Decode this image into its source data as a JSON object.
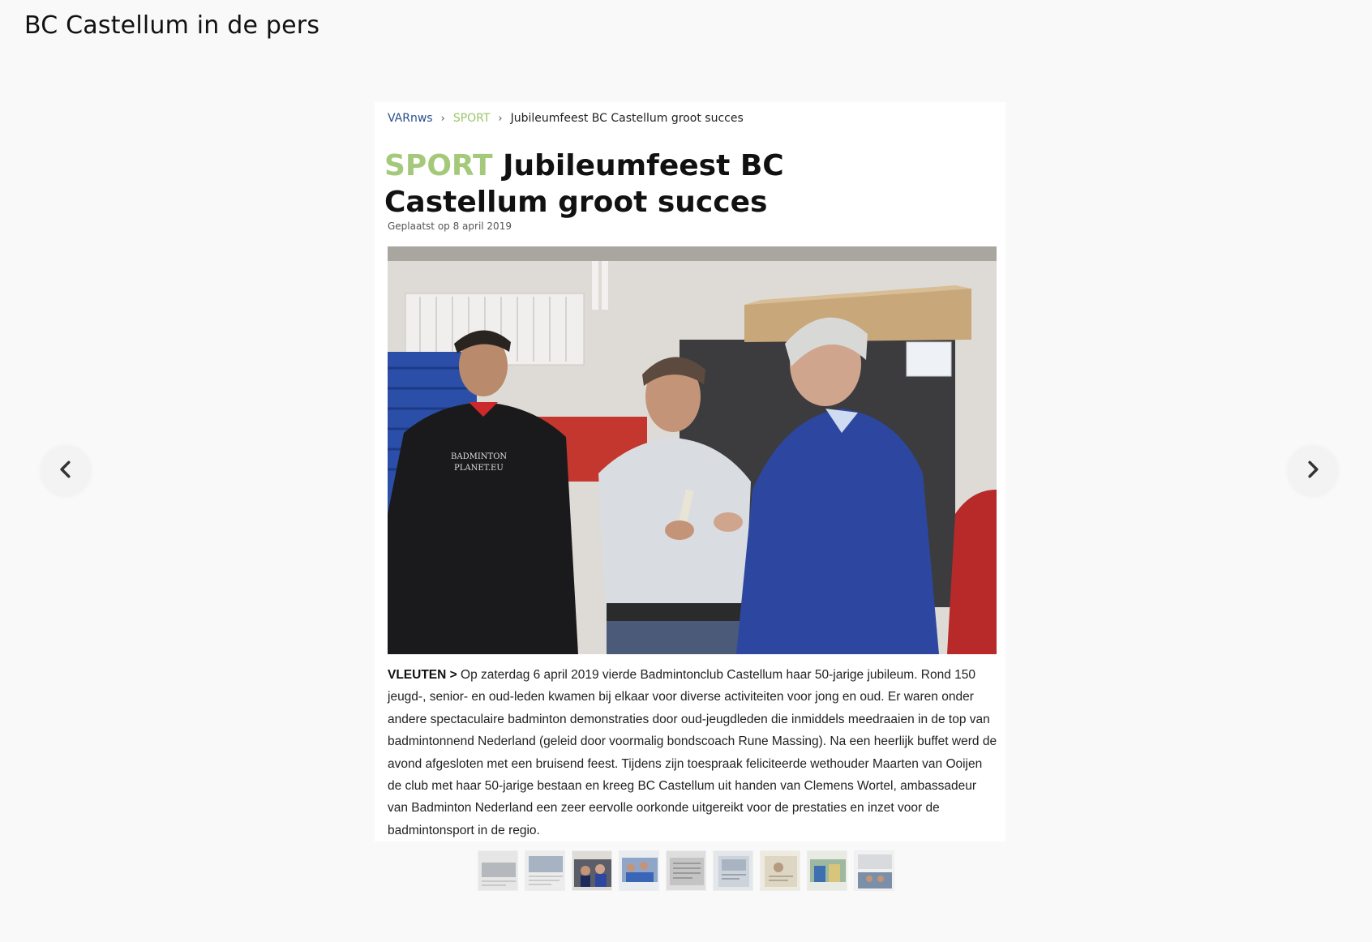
{
  "page": {
    "title": "BC Castellum in de pers"
  },
  "navigation": {
    "prev_icon": "chevron-left-icon",
    "next_icon": "chevron-right-icon"
  },
  "slide": {
    "breadcrumb": {
      "home": "VARnws",
      "separator": "›",
      "section": "SPORT",
      "current": "Jubileumfeest BC Castellum groot succes"
    },
    "headline": {
      "kicker": "SPORT",
      "title": "Jubileumfeest BC Castellum groot succes"
    },
    "posted": "Geplaatst op 8 april 2019",
    "photo_jacket_text": "BADMINTON PLANET.EU",
    "article": {
      "dateline": "VLEUTEN >",
      "body": "Op zaterdag 6 april 2019 vierde Badmintonclub Castellum haar 50-jarige jubileum. Rond 150 jeugd-, senior- en oud-leden kwamen bij elkaar voor diverse activiteiten voor jong en oud. Er waren onder andere spectaculaire badminton demonstraties door oud-jeugdleden die inmiddels meedraaien in de top van badmintonnend Nederland (geleid door voormalig bondscoach Rune Massing). Na een heerlijk buffet werd de avond afgesloten met een bruisend feest. Tijdens zijn toespraak feliciteerde wethouder Maarten van Ooijen de club met haar 50-jarige bestaan en kreeg BC Castellum uit handen van Clemens Wortel, ambassadeur van Badminton Nederland een zeer eervolle oorkonde uitgereikt voor de prestaties en inzet voor de badmintonsport in de regio."
    }
  },
  "thumbnails": {
    "count": 9,
    "active_index": 2
  },
  "colors": {
    "background": "#f9f9f9",
    "kicker_green": "#a5c97a",
    "breadcrumb_home": "#2a4f8a"
  }
}
